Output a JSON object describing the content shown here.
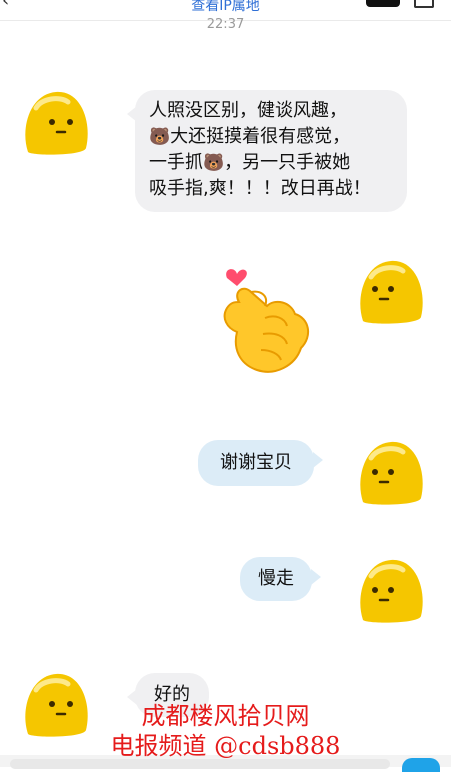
{
  "header": {
    "ip_link": "查看IP属地",
    "time": "22:37"
  },
  "messages": {
    "m1_line1": "人照没区别，健谈风趣，",
    "m1_line2": "大还挺摸着很有感觉，",
    "m1_line3a": "一手抓",
    "m1_line3b": "，另一只手被她",
    "m1_line4": "吸手指,爽！！！改日再战！",
    "m2_emoji": "pinch-heart-hand-emoji",
    "m3": "谢谢宝贝",
    "m4": "慢走",
    "m5": "好的"
  },
  "watermark": {
    "line1": "成都楼风拾贝网",
    "line2": "电报频道 @cdsb888"
  },
  "icons": {
    "bear": "🐻"
  },
  "colors": {
    "ip_link": "#2f6fd6",
    "avatar_yellow": "#f5c600",
    "bubble_left": "#f0f0f2",
    "bubble_right": "#dcecf7",
    "watermark": "#e51b1b"
  }
}
